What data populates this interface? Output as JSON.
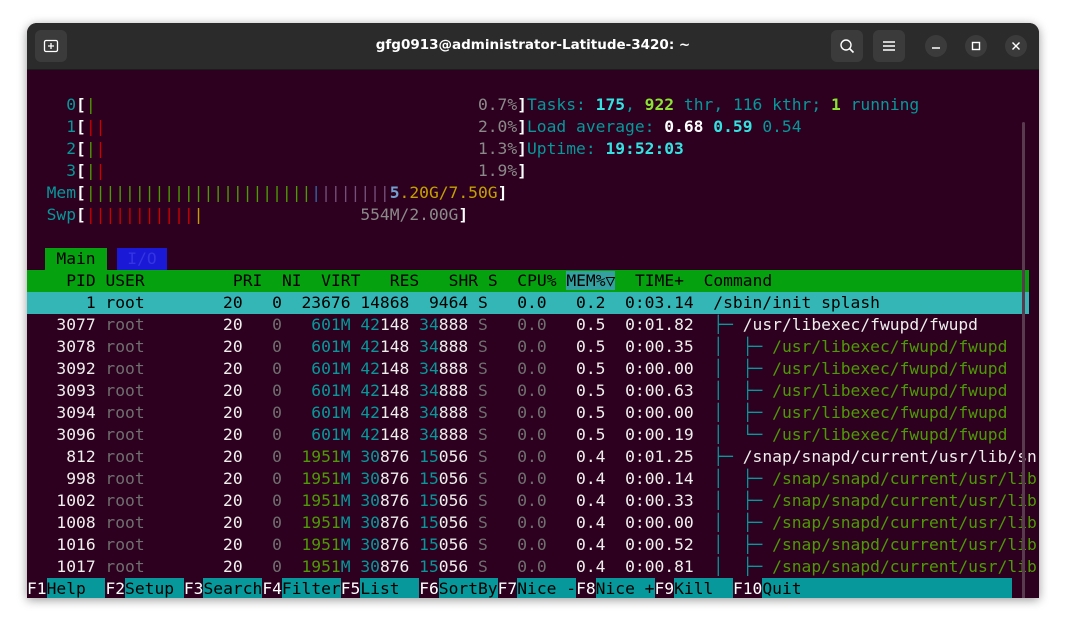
{
  "window": {
    "title": "gfg0913@administrator-Latitude-3420: ~"
  },
  "meters": {
    "cpus": [
      {
        "label": "0",
        "pct": "0.7%"
      },
      {
        "label": "1",
        "pct": "2.0%"
      },
      {
        "label": "2",
        "pct": "1.3%"
      },
      {
        "label": "3",
        "pct": "1.9%"
      }
    ],
    "mem": {
      "label": "Mem",
      "used": "5.20G/7.50G"
    },
    "swp": {
      "label": "Swp",
      "used": "554M/2.00G"
    },
    "tasks_label": "Tasks:",
    "tasks": "175",
    "threads": "922",
    "thr_label": "thr,",
    "kthreads": "116 kthr;",
    "running": "1",
    "running_label": "running",
    "load_label": "Load average:",
    "load1": "0.68",
    "load5": "0.59",
    "load15": "0.54",
    "uptime_label": "Uptime:",
    "uptime": "19:52:03"
  },
  "tabs": {
    "main": "Main",
    "io": "I/O"
  },
  "columns": [
    "PID",
    "USER",
    "PRI",
    "NI",
    "VIRT",
    "RES",
    "SHR",
    "S",
    "CPU%",
    "MEM%▽",
    "TIME+",
    "Command"
  ],
  "processes": [
    {
      "pid": "1",
      "user": "root",
      "pri": "20",
      "ni": "0",
      "virt": "23676",
      "res": "14868",
      "shr": "9464",
      "s": "S",
      "cpu": "0.0",
      "mem": "0.2",
      "time": "0:03.14",
      "cmd": "/sbin/init splash",
      "tree": ""
    },
    {
      "pid": "3077",
      "user": "root",
      "pri": "20",
      "ni": "0",
      "virt": "601M",
      "res": "42148",
      "shr": "34888",
      "s": "S",
      "cpu": "0.0",
      "mem": "0.5",
      "time": "0:01.82",
      "cmd": "/usr/libexec/fwupd/fwupd",
      "tree": "├─ "
    },
    {
      "pid": "3078",
      "user": "root",
      "pri": "20",
      "ni": "0",
      "virt": "601M",
      "res": "42148",
      "shr": "34888",
      "s": "S",
      "cpu": "0.0",
      "mem": "0.5",
      "time": "0:00.35",
      "cmd": "/usr/libexec/fwupd/fwupd",
      "tree": "│  ├─ "
    },
    {
      "pid": "3092",
      "user": "root",
      "pri": "20",
      "ni": "0",
      "virt": "601M",
      "res": "42148",
      "shr": "34888",
      "s": "S",
      "cpu": "0.0",
      "mem": "0.5",
      "time": "0:00.00",
      "cmd": "/usr/libexec/fwupd/fwupd",
      "tree": "│  ├─ "
    },
    {
      "pid": "3093",
      "user": "root",
      "pri": "20",
      "ni": "0",
      "virt": "601M",
      "res": "42148",
      "shr": "34888",
      "s": "S",
      "cpu": "0.0",
      "mem": "0.5",
      "time": "0:00.63",
      "cmd": "/usr/libexec/fwupd/fwupd",
      "tree": "│  ├─ "
    },
    {
      "pid": "3094",
      "user": "root",
      "pri": "20",
      "ni": "0",
      "virt": "601M",
      "res": "42148",
      "shr": "34888",
      "s": "S",
      "cpu": "0.0",
      "mem": "0.5",
      "time": "0:00.00",
      "cmd": "/usr/libexec/fwupd/fwupd",
      "tree": "│  ├─ "
    },
    {
      "pid": "3096",
      "user": "root",
      "pri": "20",
      "ni": "0",
      "virt": "601M",
      "res": "42148",
      "shr": "34888",
      "s": "S",
      "cpu": "0.0",
      "mem": "0.5",
      "time": "0:00.19",
      "cmd": "/usr/libexec/fwupd/fwupd",
      "tree": "│  └─ "
    },
    {
      "pid": "812",
      "user": "root",
      "pri": "20",
      "ni": "0",
      "virt": "1951M",
      "res": "30876",
      "shr": "15056",
      "s": "S",
      "cpu": "0.0",
      "mem": "0.4",
      "time": "0:01.25",
      "cmd": "/snap/snapd/current/usr/lib/sn",
      "tree": "├─ "
    },
    {
      "pid": "998",
      "user": "root",
      "pri": "20",
      "ni": "0",
      "virt": "1951M",
      "res": "30876",
      "shr": "15056",
      "s": "S",
      "cpu": "0.0",
      "mem": "0.4",
      "time": "0:00.14",
      "cmd": "/snap/snapd/current/usr/lib",
      "tree": "│  ├─ "
    },
    {
      "pid": "1002",
      "user": "root",
      "pri": "20",
      "ni": "0",
      "virt": "1951M",
      "res": "30876",
      "shr": "15056",
      "s": "S",
      "cpu": "0.0",
      "mem": "0.4",
      "time": "0:00.33",
      "cmd": "/snap/snapd/current/usr/lib",
      "tree": "│  ├─ "
    },
    {
      "pid": "1008",
      "user": "root",
      "pri": "20",
      "ni": "0",
      "virt": "1951M",
      "res": "30876",
      "shr": "15056",
      "s": "S",
      "cpu": "0.0",
      "mem": "0.4",
      "time": "0:00.00",
      "cmd": "/snap/snapd/current/usr/lib",
      "tree": "│  ├─ "
    },
    {
      "pid": "1016",
      "user": "root",
      "pri": "20",
      "ni": "0",
      "virt": "1951M",
      "res": "30876",
      "shr": "15056",
      "s": "S",
      "cpu": "0.0",
      "mem": "0.4",
      "time": "0:00.52",
      "cmd": "/snap/snapd/current/usr/lib",
      "tree": "│  ├─ "
    },
    {
      "pid": "1017",
      "user": "root",
      "pri": "20",
      "ni": "0",
      "virt": "1951M",
      "res": "30876",
      "shr": "15056",
      "s": "S",
      "cpu": "0.0",
      "mem": "0.4",
      "time": "0:00.81",
      "cmd": "/snap/snapd/current/usr/lib",
      "tree": "│  ├─ "
    }
  ],
  "fkeys": [
    {
      "key": "F1",
      "label": "Help  "
    },
    {
      "key": "F2",
      "label": "Setup "
    },
    {
      "key": "F3",
      "label": "Search"
    },
    {
      "key": "F4",
      "label": "Filter"
    },
    {
      "key": "F5",
      "label": "List  "
    },
    {
      "key": "F6",
      "label": "SortBy"
    },
    {
      "key": "F7",
      "label": "Nice -"
    },
    {
      "key": "F8",
      "label": "Nice +"
    },
    {
      "key": "F9",
      "label": "Kill  "
    },
    {
      "key": "F10",
      "label": "Quit"
    }
  ],
  "icons": {
    "new_tab": "new-tab-icon",
    "search": "search-icon",
    "menu": "hamburger-menu-icon",
    "minimize": "minimize-icon",
    "maximize": "maximize-icon",
    "close": "close-icon"
  }
}
